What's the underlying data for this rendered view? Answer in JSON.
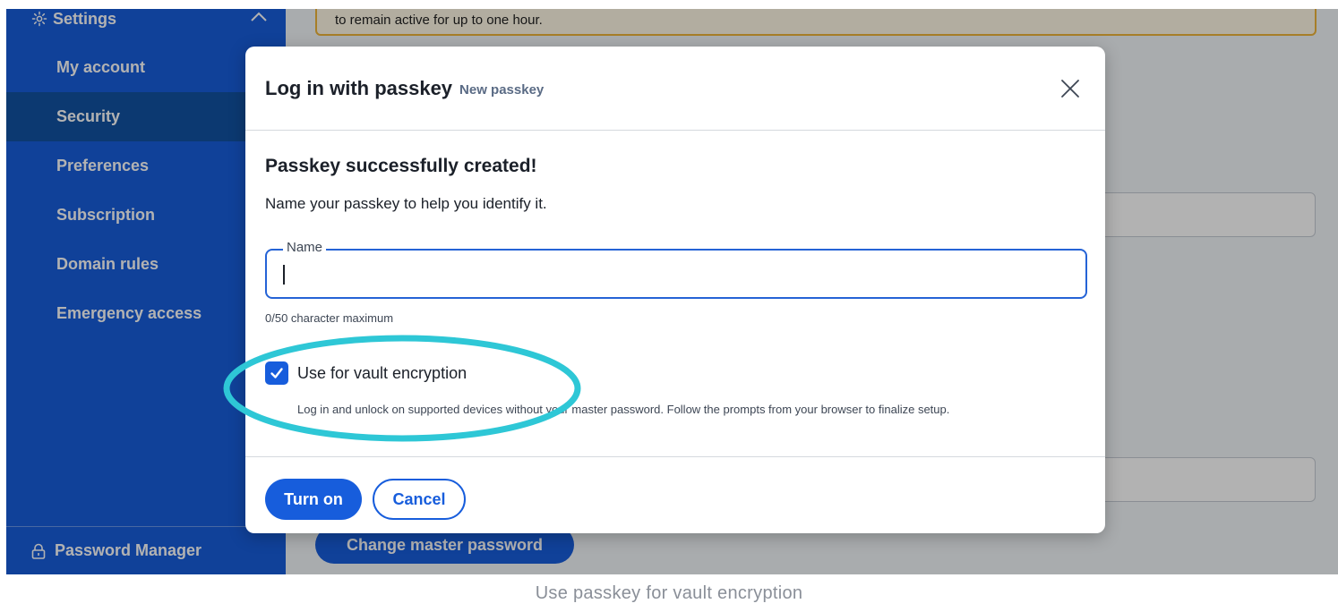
{
  "sidebar": {
    "header": "Settings",
    "items": [
      {
        "label": "My account"
      },
      {
        "label": "Security"
      },
      {
        "label": "Preferences"
      },
      {
        "label": "Subscription"
      },
      {
        "label": "Domain rules"
      },
      {
        "label": "Emergency access"
      }
    ],
    "footer": "Password Manager"
  },
  "main": {
    "notice": "to remain active for up to one hour.",
    "change_password_button": "Change master password"
  },
  "dialog": {
    "title": "Log in with passkey",
    "subtitle": "New passkey",
    "success_heading": "Passkey successfully created!",
    "instruction": "Name your passkey to help you identify it.",
    "name_field": {
      "label": "Name",
      "value": "",
      "hint": "0/50 character maximum"
    },
    "vault_encryption": {
      "label": "Use for vault encryption",
      "checked": true,
      "description": "Log in and unlock on supported devices without your master password. Follow the prompts from your browser to finalize setup."
    },
    "buttons": {
      "primary": "Turn on",
      "secondary": "Cancel"
    }
  },
  "caption": "Use passkey for vault encryption",
  "colors": {
    "brand": "#175ddc",
    "highlight": "#2ec7d6",
    "warning_border": "#f0b53a"
  }
}
